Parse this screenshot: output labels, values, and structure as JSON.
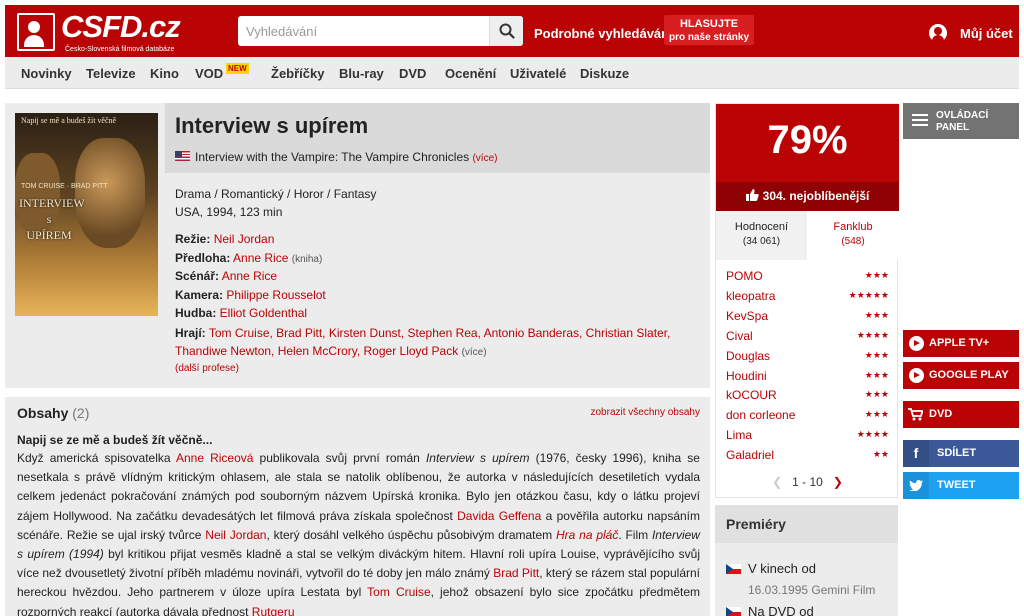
{
  "header": {
    "logo_text": "CSFD.cz",
    "logo_sub": "Česko-Slovenská filmová databáze",
    "search_placeholder": "Vyhledávání",
    "advanced_search": "Podrobné vyhledávání",
    "vote_line1": "HLASUJTE",
    "vote_line2": "pro naše stránky",
    "account": "Můj účet"
  },
  "nav": {
    "items": [
      "Novinky",
      "Televize",
      "Kino",
      "VOD",
      "Žebříčky",
      "Blu-ray",
      "DVD",
      "Ocenění",
      "Uživatelé",
      "Diskuze"
    ],
    "new_badge": "NEW"
  },
  "film": {
    "title": "Interview s upírem",
    "original_title": "Interview with the Vampire: The Vampire Chronicles",
    "more": "(více)",
    "genres": "Drama / Romantický / Horor / Fantasy",
    "origin": "USA, 1994, 123 min",
    "poster": {
      "tagline": "Napij se mě a budeš žít věčně",
      "title_line1": "INTERVIEW",
      "title_line2": "s",
      "title_line3": "UPÍREM",
      "stars": "TOM CRUISE · BRAD PITT"
    },
    "crew": [
      {
        "label": "Režie:",
        "value": "Neil Jordan",
        "note": ""
      },
      {
        "label": "Předloha:",
        "value": "Anne Rice",
        "note": "(kniha)"
      },
      {
        "label": "Scénář:",
        "value": "Anne Rice",
        "note": ""
      },
      {
        "label": "Kamera:",
        "value": "Philippe Rousselot",
        "note": ""
      },
      {
        "label": "Hudba:",
        "value": "Elliot Goldenthal",
        "note": ""
      }
    ],
    "actors_label": "Hrají:",
    "actors": "Tom Cruise, Brad Pitt, Kirsten Dunst, Stephen Rea, Antonio Banderas, Christian Slater, Thandiwe Newton, Helen McCrory, Roger Lloyd Pack",
    "actors_more": "(více)",
    "more_professions": "(další profese)"
  },
  "plot": {
    "title": "Obsahy",
    "count": "(2)",
    "show_all": "zobrazit všechny obsahy",
    "headline": "Napij se ze mě a budeš žít věčně...",
    "p1": "Když americká spisovatelka ",
    "l1": "Anne Riceová",
    "p2": " publikovala svůj první román ",
    "i1": "Interview s upírem",
    "p3": " (1976, česky 1996), kniha se nesetkala s právě vlídným kritickým ohlasem, ale stala se natolik oblíbenou, že autorka v následujících desetiletích vydala celkem jedenáct pokračování známých pod souborným názvem Upírská kronika. Bylo jen otázkou času, kdy o látku projeví zájem Hollywood. Na začátku devadesátých let filmová práva získala společnost ",
    "l2": "Davida Geffena",
    "p4": " a pověřila autorku napsáním scénáře. Režie se ujal irský tvůrce ",
    "l3": "Neil Jordan",
    "p5": ", který dosáhl velkého úspěchu působivým dramatem ",
    "l4": "Hra na pláč",
    "p6": ". Film ",
    "i2": "Interview s upírem (1994)",
    "p7": " byl kritikou přijat vesměs kladně a stal se velkým diváckým hitem. Hlavní roli upíra Louise, vyprávějícího svůj více než dvousetletý životní příběh mladému novináři, vytvořil do té doby jen málo známý ",
    "l5": "Brad Pitt",
    "p8": ", který se rázem stal populární hereckou hvězdou. Jeho partnerem v úloze upíra Lestata byl ",
    "l6": "Tom Cruise",
    "p9": ", jehož obsazení bylo sice zpočátku předmětem rozporných reakcí (autorka dávala přednost ",
    "l7": "Rutgeru"
  },
  "rating": {
    "percent": "79%",
    "rank": "304. nejoblíbenější",
    "tab_ratings": "Hodnocení",
    "tab_ratings_count": "(34 061)",
    "tab_fanclub": "Fanklub",
    "tab_fanclub_count": "(548)",
    "users": [
      {
        "name": "POMO",
        "stars": "★★★"
      },
      {
        "name": "kleopatra",
        "stars": "★★★★★"
      },
      {
        "name": "KevSpa",
        "stars": "★★★"
      },
      {
        "name": "Cival",
        "stars": "★★★★"
      },
      {
        "name": "Douglas",
        "stars": "★★★"
      },
      {
        "name": "Houdini",
        "stars": "★★★"
      },
      {
        "name": "kOCOUR",
        "stars": "★★★"
      },
      {
        "name": "don corleone",
        "stars": "★★★"
      },
      {
        "name": "Lima",
        "stars": "★★★★"
      },
      {
        "name": "Galadriel",
        "stars": "★★"
      }
    ],
    "pager": "1 - 10"
  },
  "premiery": {
    "title": "Premiéry",
    "cinema": "V kinech od",
    "cinema_date": "16.03.1995 Gemini Film",
    "dvd": "Na DVD od"
  },
  "sidebar": {
    "control_panel": "OVLÁDACÍ PANEL",
    "apple_tv": "APPLE TV+",
    "google_play": "GOOGLE PLAY",
    "dvd": "DVD",
    "share": "SDÍLET",
    "tweet": "TWEET"
  },
  "colors": {
    "brand": "#ba0305",
    "brand_dark": "#8f0204",
    "facebook": "#3b5998",
    "twitter": "#1da1f2"
  }
}
